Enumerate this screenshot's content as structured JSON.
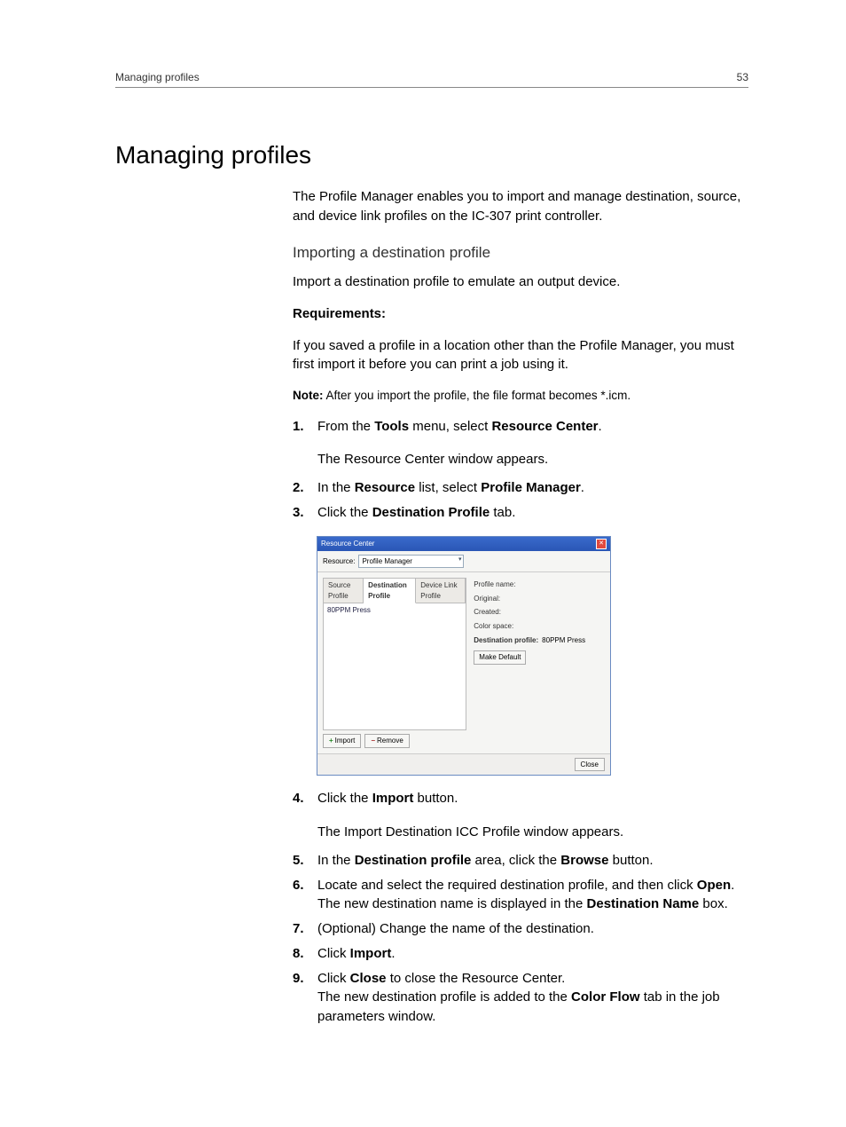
{
  "header": {
    "section": "Managing profiles",
    "page_number": "53"
  },
  "title": "Managing profiles",
  "intro": "The Profile Manager enables you to import and manage destination, source, and device link profiles on the IC-307 print controller.",
  "subheading": "Importing a destination profile",
  "sub_intro": "Import a destination profile to emulate an output device.",
  "requirements_label": "Requirements:",
  "requirements_text": "If you saved a profile in a location other than the Profile Manager, you must first import it before you can print a job using it.",
  "note_label": "Note:",
  "note_text": " After you import the profile, the file format becomes *.icm.",
  "steps_a": [
    {
      "n": "1.",
      "pre": "From the ",
      "b1": "Tools",
      "mid": " menu, select ",
      "b2": "Resource Center",
      "post": ".",
      "result": "The Resource Center window appears."
    },
    {
      "n": "2.",
      "pre": "In the ",
      "b1": "Resource",
      "mid": " list, select ",
      "b2": "Profile Manager",
      "post": "."
    },
    {
      "n": "3.",
      "pre": "Click the ",
      "b1": "Destination Profile",
      "mid": "",
      "b2": "",
      "post": " tab."
    }
  ],
  "app": {
    "title": "Resource Center",
    "resource_label": "Resource:",
    "resource_value": "Profile Manager",
    "tabs": {
      "source": "Source Profile",
      "destination": "Destination Profile",
      "devicelink": "Device Link Profile"
    },
    "list_item": "80PPM Press",
    "props": {
      "profile_name_label": "Profile name:",
      "original_label": "Original:",
      "created_label": "Created:",
      "colorspace_label": "Color space:",
      "dest_profile_label": "Destination profile:",
      "dest_profile_value": "80PPM Press"
    },
    "make_default": "Make Default",
    "import_btn": "Import",
    "remove_btn": "Remove",
    "close_btn": "Close"
  },
  "steps_b": [
    {
      "n": "4.",
      "pre": "Click the ",
      "b1": "Import",
      "mid": "",
      "b2": "",
      "post": " button.",
      "result": "The Import Destination ICC Profile window appears."
    },
    {
      "n": "5.",
      "pre": "In the ",
      "b1": "Destination profile",
      "mid": " area, click the ",
      "b2": "Browse",
      "post": " button."
    },
    {
      "n": "6.",
      "pre": "Locate and select the required destination profile, and then click ",
      "b1": "Open",
      "mid": "",
      "b2": "",
      "post": ".",
      "extra_pre": "The new destination name is displayed in the ",
      "extra_b": "Destination Name",
      "extra_post": " box."
    },
    {
      "n": "7.",
      "pre": "(Optional) Change the name of the destination.",
      "b1": "",
      "mid": "",
      "b2": "",
      "post": ""
    },
    {
      "n": "8.",
      "pre": "Click ",
      "b1": "Import",
      "mid": "",
      "b2": "",
      "post": "."
    },
    {
      "n": "9.",
      "pre": "Click ",
      "b1": "Close",
      "mid": " to close the Resource Center.",
      "b2": "",
      "post": "",
      "extra_pre": "The new destination profile is added to the ",
      "extra_b": "Color Flow",
      "extra_post": " tab in the job parameters window."
    }
  ]
}
